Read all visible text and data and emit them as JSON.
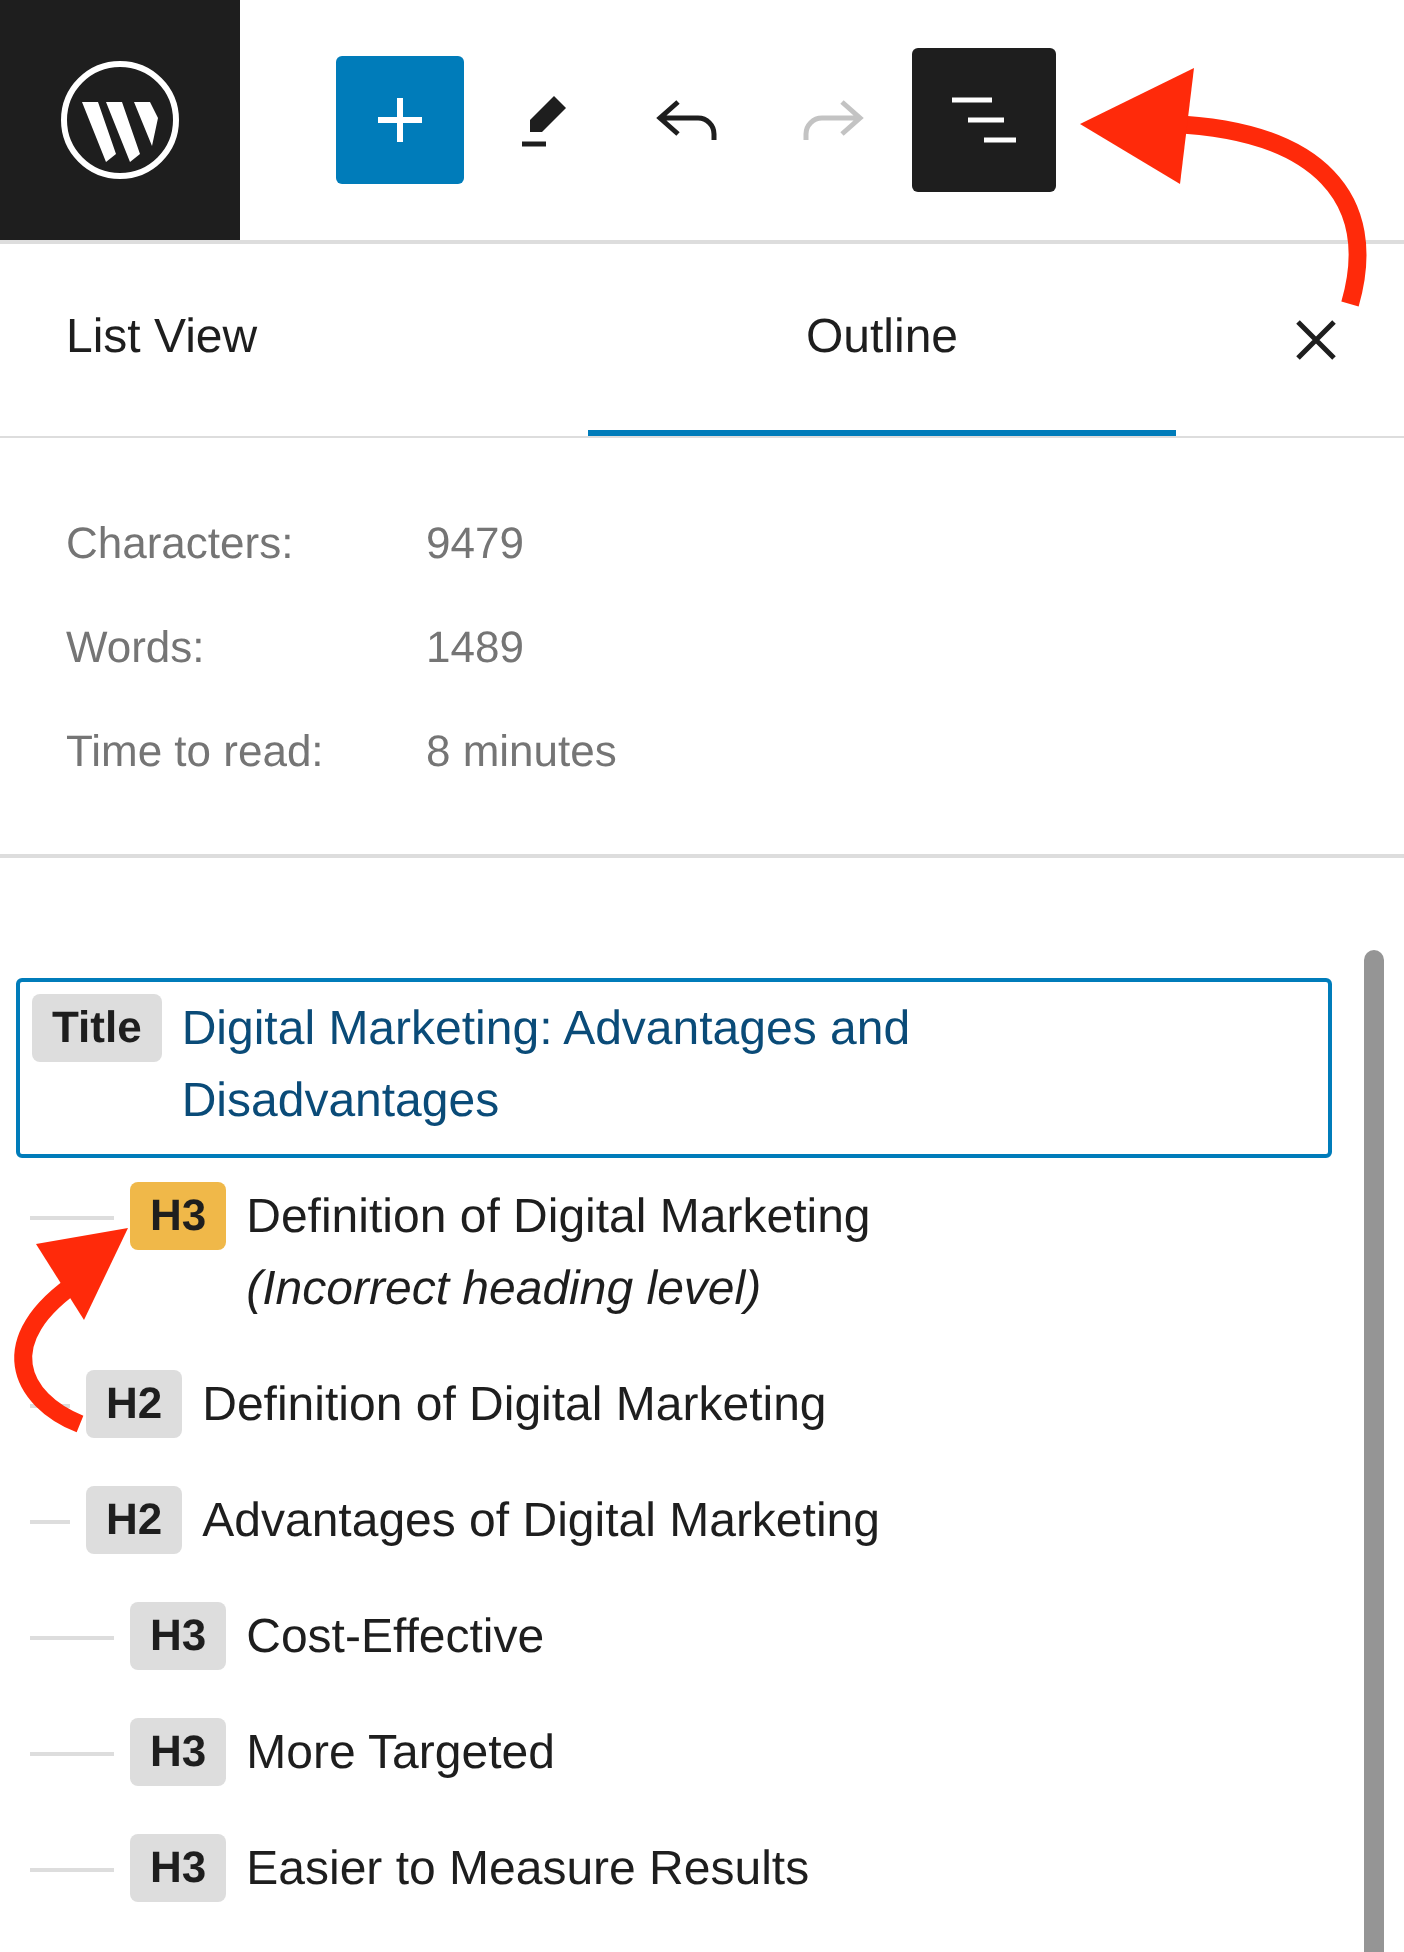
{
  "toolbar": {
    "buttons": [
      {
        "kind": "add",
        "pressed": false,
        "disabled": false
      },
      {
        "kind": "edit",
        "pressed": false,
        "disabled": false
      },
      {
        "kind": "undo",
        "pressed": false,
        "disabled": false
      },
      {
        "kind": "redo",
        "pressed": false,
        "disabled": true
      },
      {
        "kind": "outline",
        "pressed": true,
        "disabled": false
      }
    ]
  },
  "panel": {
    "tabs": [
      {
        "label": "List View",
        "selected": false
      },
      {
        "label": "Outline",
        "selected": true
      }
    ],
    "stats": [
      {
        "label": "Characters:",
        "value": "9479"
      },
      {
        "label": "Words:",
        "value": "1489"
      },
      {
        "label": "Time to read:",
        "value": "8 minutes"
      }
    ],
    "outline": [
      {
        "level": "Title",
        "text": "Digital Marketing: Advantages and Disadvantages",
        "selected": true,
        "kind": "title",
        "children": [
          {
            "level": "H3",
            "text": "Definition of Digital Marketing",
            "note": "(Incorrect heading level)",
            "kind": "misplaced"
          },
          {
            "level": "H2",
            "text": "Definition of Digital Marketing",
            "kind": "heading"
          },
          {
            "level": "H2",
            "text": "Advantages of Digital Marketing",
            "kind": "heading",
            "children": [
              {
                "level": "H3",
                "text": "Cost-Effective",
                "kind": "heading"
              },
              {
                "level": "H3",
                "text": "More Targeted",
                "kind": "heading"
              },
              {
                "level": "H3",
                "text": "Easier to Measure Results",
                "kind": "heading"
              }
            ]
          }
        ]
      }
    ]
  }
}
